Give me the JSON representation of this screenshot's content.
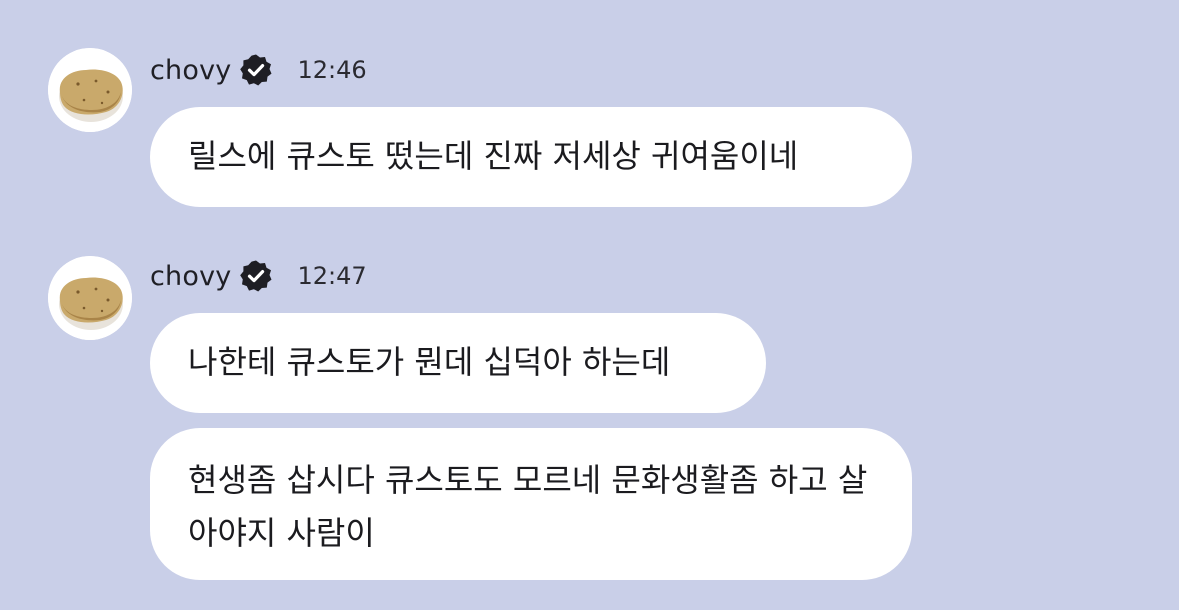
{
  "background_color": "#c9cfe8",
  "groups": [
    {
      "sender": "chovy",
      "verified_icon": "verified-badge-icon",
      "avatar_icon": "potato-avatar-icon",
      "time": "12:46",
      "messages": [
        "릴스에 큐스토 떴는데 진짜 저세상 귀여움이네"
      ]
    },
    {
      "sender": "chovy",
      "verified_icon": "verified-badge-icon",
      "avatar_icon": "potato-avatar-icon",
      "time": "12:47",
      "messages": [
        "나한테 큐스토가 뭔데 십덕아 하는데",
        "현생좀 삽시다 큐스토도 모르네 문화생활좀 하고 살아야지 사람이"
      ]
    }
  ]
}
